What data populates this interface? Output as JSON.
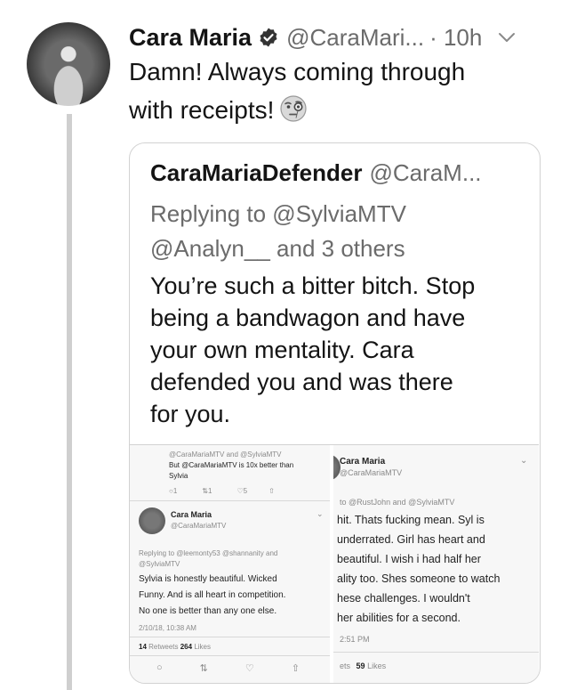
{
  "tweet": {
    "author_name": "Cara Maria",
    "handle": "@CaraMari...",
    "time": "· 10h",
    "text_line1": "Damn! Always coming through",
    "text_line2": "with receipts!"
  },
  "quoted_tweet": {
    "author_name": "CaraMariaDefender",
    "handle": "@CaraM...",
    "reply_line1": "Replying to @SylviaMTV",
    "reply_line2": "@Analyn__ and 3 others",
    "text_lines": [
      "You’re such a bitter bitch. Stop",
      "being a bandwagon and have",
      "your own mentality. Cara",
      "defended you and was there",
      "for you."
    ]
  },
  "screenshot_left": {
    "top_reply_line1": "@CaraMariaMTV and @SylviaMTV",
    "top_text_line1": "But @CaraMariaMTV is 10x better than",
    "top_text_line2": "Sylvia",
    "top_counts": [
      "1",
      "1",
      "5"
    ],
    "author_name": "Cara Maria",
    "handle": "@CaraMariaMTV",
    "reply_line1": "Replying to @leemonty53 @shannanity and",
    "reply_line2": "@SylviaMTV",
    "text_lines": [
      "Sylvia is honestly beautiful. Wicked",
      "Funny. And is all heart in competition.",
      "No one is better than any one else."
    ],
    "timestamp": "2/10/18, 10:38 AM",
    "retweets_count": "14",
    "retweets_label": "Retweets",
    "likes_count": "264",
    "likes_label": "Likes"
  },
  "screenshot_right": {
    "author_name": "Cara Maria",
    "handle": "@CaraMariaMTV",
    "reply_line": "to @RustJohn and @SylviaMTV",
    "text_lines": [
      "hit. Thats fucking mean. Syl is",
      "underrated. Girl has heart and",
      "beautiful. I wish i had half her",
      "ality too. Shes someone to watch",
      "hese challenges. I wouldn't",
      "her abilities for a second."
    ],
    "timestamp": "2:51 PM",
    "retweets_label": "ets",
    "likes_count": "59",
    "likes_label": "Likes"
  },
  "icons": {
    "verified": "verified-badge-icon",
    "chevron": "chevron-down-icon",
    "emoji": "face-with-monocle-emoji"
  },
  "colors": {
    "text": "#141414",
    "secondary": "#6b6b6b",
    "border": "#d2d2d2",
    "thread_line": "#cfcfcf"
  }
}
